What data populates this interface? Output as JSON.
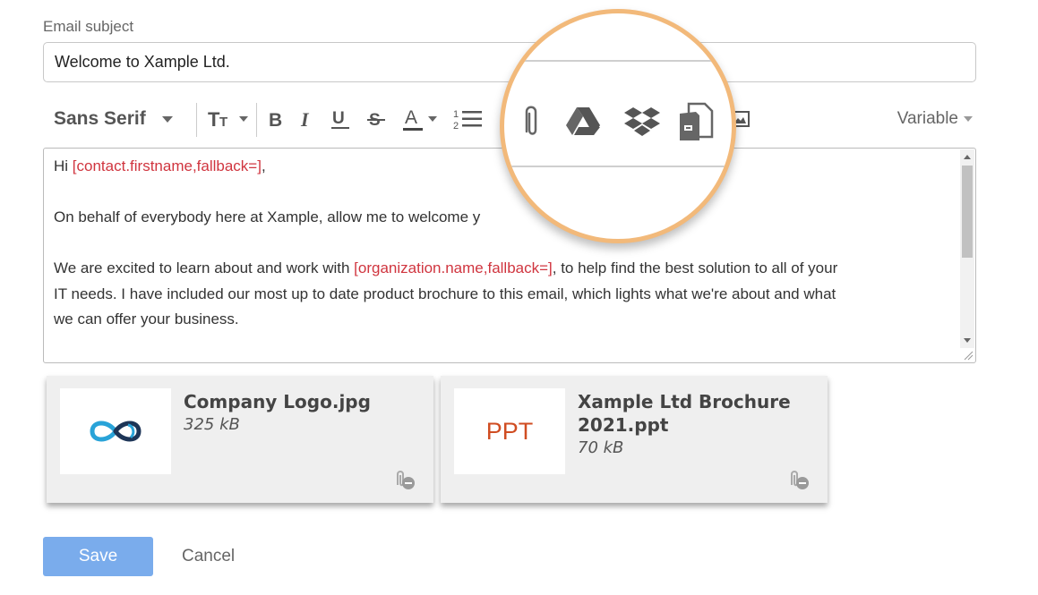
{
  "form": {
    "subject_label": "Email subject",
    "subject_value": "Welcome to Xample Ltd."
  },
  "toolbar": {
    "font_family": "Sans Serif",
    "variable_label": "Variable",
    "icons": [
      "font-size-icon",
      "bold-icon",
      "italic-icon",
      "underline-icon",
      "strikethrough-icon",
      "text-color-icon",
      "numbered-list-icon",
      "attachment-icon",
      "google-drive-icon",
      "dropbox-icon",
      "document-library-icon",
      "image-icon"
    ]
  },
  "body": {
    "greeting_prefix": "Hi ",
    "greeting_var": "[contact.firstname,fallback=]",
    "greeting_suffix": ",",
    "para1": "On behalf of everybody here at Xample, allow me to welcome y",
    "para1_end": "y.",
    "para2_prefix": "We are excited to learn about and work with ",
    "para2_var": "[organization.name,fallback=]",
    "para2_line1_suffix": ", to help find the best solution to all of your",
    "para2_line2": "IT needs. I have included our most up to date product brochure to this email, which lights what we're about and what",
    "para2_line3": "we can offer your business."
  },
  "attachments": [
    {
      "name": "Company Logo.jpg",
      "size": "325 kB"
    },
    {
      "name": "Xample Ltd Brochure 2021.ppt",
      "size": "70 kB",
      "thumb_label": "PPT"
    }
  ],
  "actions": {
    "save_label": "Save",
    "cancel_label": "Cancel"
  },
  "colors": {
    "variable": "#d0353f",
    "save_button": "#7aacec",
    "magnifier_ring": "#f2b97a",
    "ppt": "#d04d22"
  }
}
